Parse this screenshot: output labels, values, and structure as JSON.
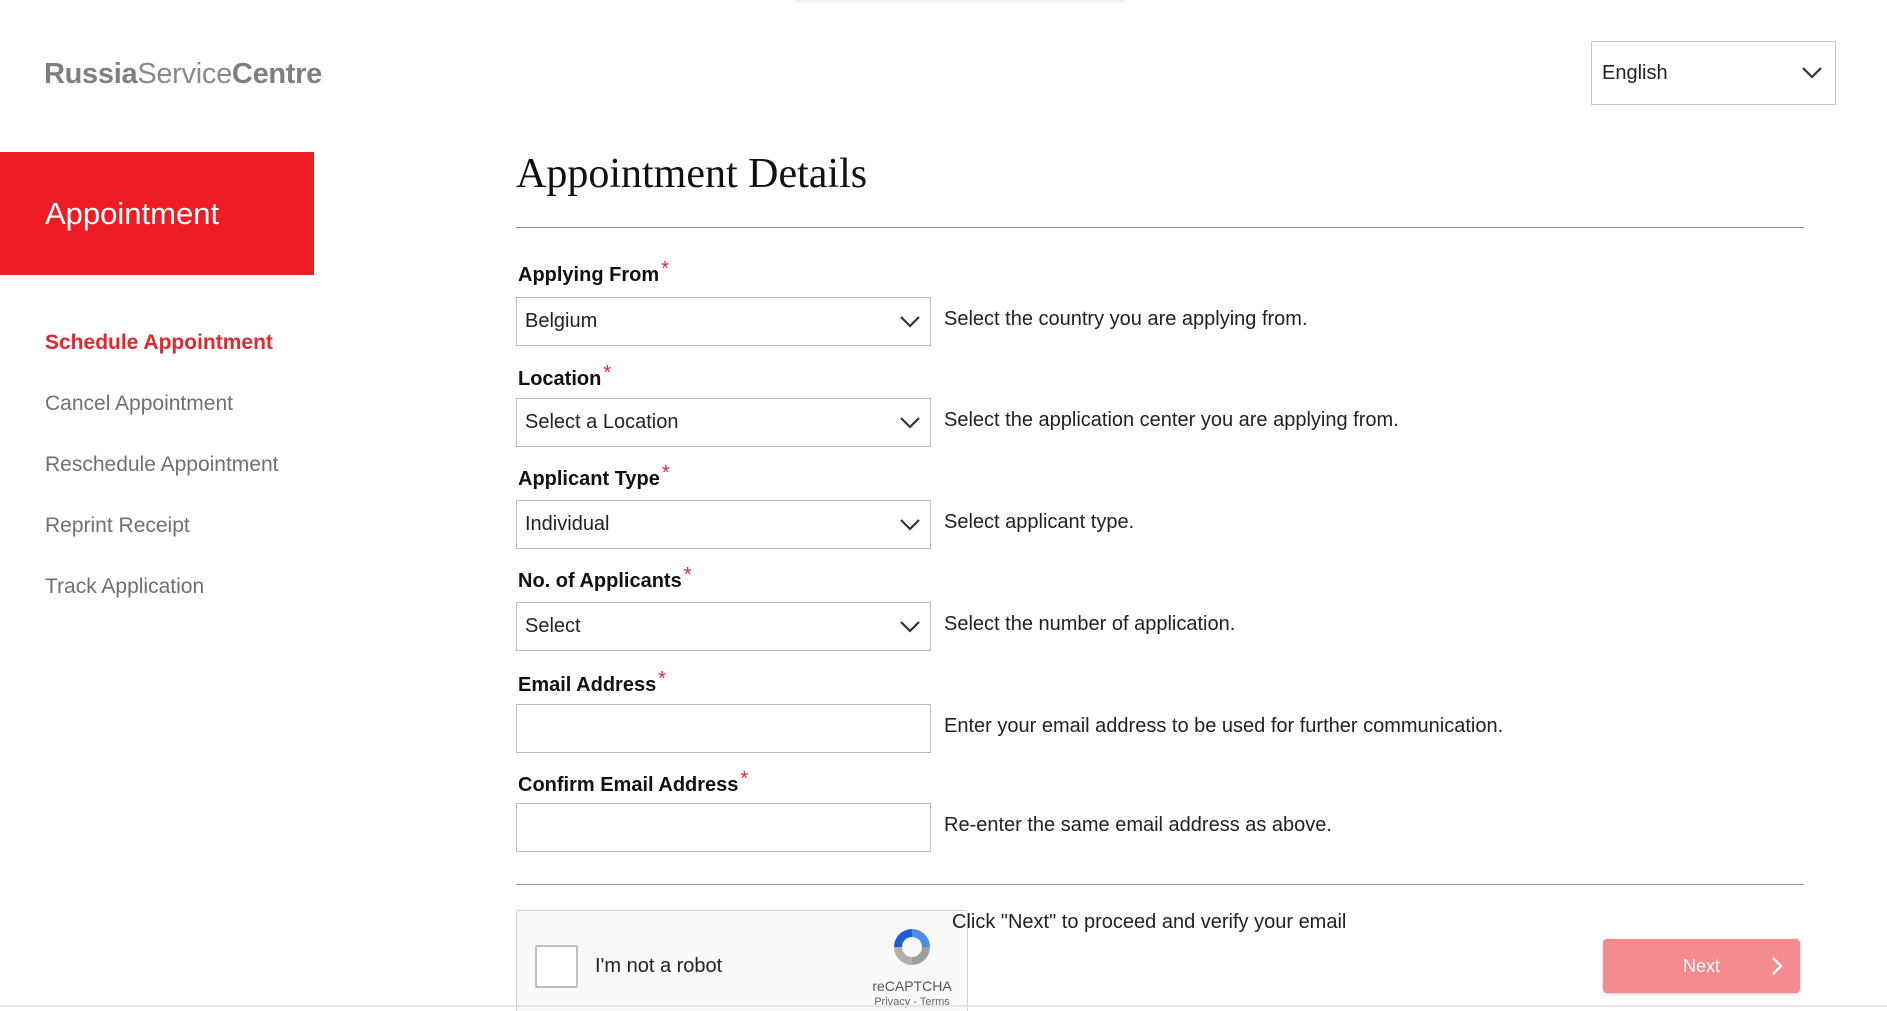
{
  "header": {
    "logo_bold_1": "Russia",
    "logo_light": "Service",
    "logo_bold_2": "Centre",
    "language": "English"
  },
  "sidebar": {
    "banner": "Appointment",
    "items": [
      {
        "label": "Schedule Appointment",
        "active": true
      },
      {
        "label": "Cancel Appointment",
        "active": false
      },
      {
        "label": "Reschedule Appointment",
        "active": false
      },
      {
        "label": "Reprint Receipt",
        "active": false
      },
      {
        "label": "Track Application",
        "active": false
      }
    ]
  },
  "main": {
    "title": "Appointment Details",
    "required_marker": "*",
    "fields": {
      "applying_from": {
        "label": "Applying From",
        "value": "Belgium",
        "help": "Select the country you are applying from."
      },
      "location": {
        "label": "Location",
        "value": "Select a Location",
        "help": "Select the application center you are applying from."
      },
      "applicant_type": {
        "label": "Applicant Type",
        "value": "Individual",
        "help": "Select applicant type."
      },
      "num_applicants": {
        "label": "No. of Applicants",
        "value": "Select",
        "help": "Select the number of application."
      },
      "email": {
        "label": "Email Address",
        "value": "",
        "help": "Enter your email address to be used for further communication."
      },
      "confirm_email": {
        "label": "Confirm Email Address",
        "value": "",
        "help": "Re-enter the same email address as above."
      }
    },
    "recaptcha": {
      "label": "I'm not a robot",
      "brand": "reCAPTCHA",
      "links": "Privacy - Terms"
    },
    "next_note": "Click \"Next\" to proceed and verify your email",
    "next_label": "Next"
  },
  "colors": {
    "accent_red": "#ee1c25",
    "next_button": "#f48b8f"
  }
}
